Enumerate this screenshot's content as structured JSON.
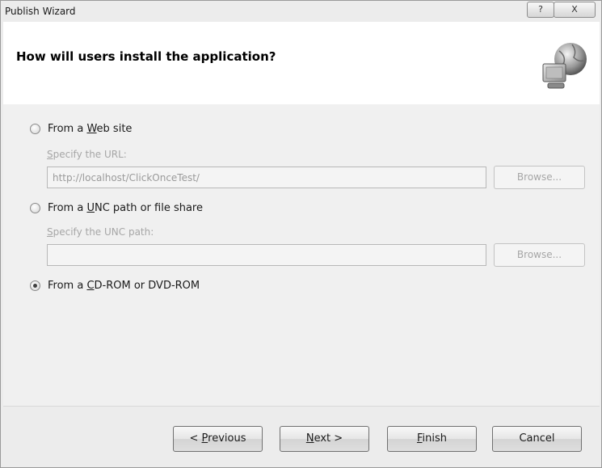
{
  "window": {
    "title": "Publish Wizard",
    "help_glyph": "?",
    "close_glyph": "X"
  },
  "header": {
    "title": "How will users install the application?",
    "icon": "globe-computer-icon"
  },
  "options": {
    "web": {
      "label_pre": "From a ",
      "label_key": "W",
      "label_post": "eb site",
      "checked": false,
      "field_label_key": "S",
      "field_label_rest": "pecify the URL:",
      "value": "http://localhost/ClickOnceTest/",
      "browse_label": "Browse..."
    },
    "unc": {
      "label_pre": "From a ",
      "label_key": "U",
      "label_post": "NC path or file share",
      "checked": false,
      "field_label_key": "S",
      "field_label_rest": "pecify the UNC path:",
      "value": "",
      "browse_label": "Browse..."
    },
    "cd": {
      "label_pre": "From a ",
      "label_key": "C",
      "label_post": "D-ROM or DVD-ROM",
      "checked": true
    }
  },
  "buttons": {
    "previous": {
      "pre": "< ",
      "key": "P",
      "post": "revious"
    },
    "next": {
      "pre": "",
      "key": "N",
      "post": "ext >"
    },
    "finish": {
      "pre": "",
      "key": "F",
      "post": "inish"
    },
    "cancel": {
      "label": "Cancel"
    }
  }
}
